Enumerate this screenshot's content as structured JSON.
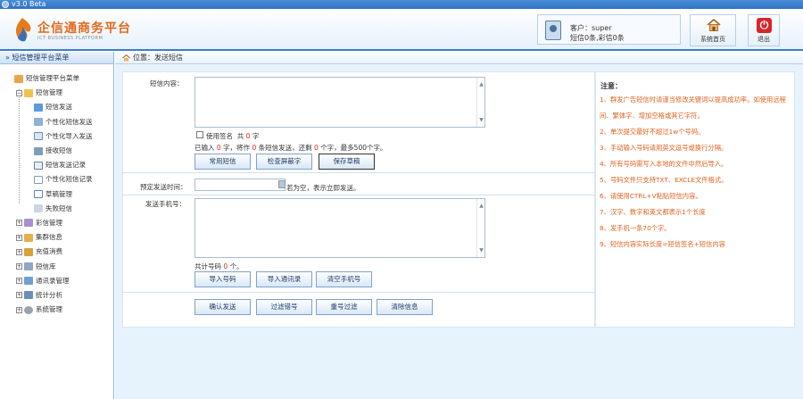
{
  "window": {
    "title": "v3.0  Beta"
  },
  "brand": {
    "name": "企信通商务平台",
    "subtitle": "ICT BUSINESS PLATFORM"
  },
  "user": {
    "label": "客户：super",
    "counts": "短信0条,彩信0条"
  },
  "header_buttons": {
    "home": "系统首页",
    "exit": "退出"
  },
  "sidebar": {
    "title": "» 短信管理平台菜单",
    "root": "短信管理平台菜单",
    "group": "短信管理",
    "items": [
      "短信发送",
      "个性化短信发送",
      "个性化导入发送",
      "接收短信",
      "短信发送记录",
      "个性化短信记录",
      "草稿管理",
      "失败短信"
    ],
    "groups": [
      "彩信管理",
      "集群信息",
      "充值消费",
      "短信库",
      "通讯录管理",
      "统计分析",
      "系统管理"
    ]
  },
  "location": {
    "text": "位置：发送短信"
  },
  "form": {
    "content_label": "短信内容：",
    "signature_label": "使用签名",
    "signature_count_prefix": "共",
    "signature_count": "0",
    "signature_count_suffix": "字",
    "input_prefix": "已输入",
    "input_count": "0",
    "input_mid": "字，将作",
    "split_count": "0",
    "split_mid": "条短信发送，还剩",
    "remain_count": "0",
    "remain_suffix": "个字，最多500个字。",
    "buttons_row1": [
      "常用短信",
      "检查屏蔽字",
      "保存草稿"
    ],
    "schedule_label": "预定发送时间：",
    "schedule_hint": "若为空，表示立即发送。",
    "phones_label": "发送手机号：",
    "phone_total_prefix": "共计号码",
    "phone_total": "0",
    "phone_total_suffix": "个。",
    "buttons_row2": [
      "导入号码",
      "导入通讯录",
      "清空手机号"
    ],
    "buttons_row3": [
      "确认发送",
      "过滤错号",
      "重号过滤",
      "清除信息"
    ]
  },
  "notes": {
    "title": "注意：",
    "items": [
      "1、群发广告短信时请谨当修改关键词以提高成功率。如使用远程",
      "间、繁体字、增加空格或其它字符。",
      "2、单次提交最好不超过1w个号码。",
      "3、手动输入号码请用英文逗号或换行分隔。",
      "4、所有号码需写入本地的文件中然后导入。",
      "5、号码文件只支持TXT、EXCLE文件格式。",
      "6、请使用CTRL+V粘贴短信内容。",
      "7、汉字、数字和英文都表示1个长度",
      "8、发手机一条70个字。",
      "9、短信内容实际长度=短信签名+短信内容"
    ]
  },
  "colors": {
    "accent": "#3c7dc4",
    "notes_text": "#e0621e",
    "warning_red": "#e0261e"
  }
}
